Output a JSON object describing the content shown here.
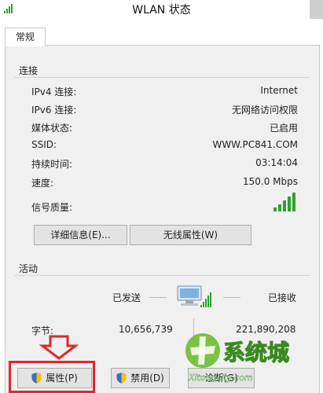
{
  "window": {
    "title": "WLAN 状态"
  },
  "tabs": [
    {
      "label": "常规"
    }
  ],
  "connection": {
    "heading": "连接",
    "rows": [
      {
        "label": "IPv4 连接:",
        "value": "Internet"
      },
      {
        "label": "IPv6 连接:",
        "value": "无网络访问权限"
      },
      {
        "label": "媒体状态:",
        "value": "已启用"
      },
      {
        "label": "SSID:",
        "value": "WWW.PC841.COM"
      },
      {
        "label": "持续时间:",
        "value": "03:14:04"
      },
      {
        "label": "速度:",
        "value": "150.0 Mbps"
      },
      {
        "label": "信号质量:",
        "value": ""
      }
    ],
    "signal_bars": 5,
    "details_button": "详细信息(E)...",
    "wireless_props_button": "无线属性(W)"
  },
  "activity": {
    "heading": "活动",
    "sent_label": "已发送",
    "received_label": "已接收",
    "bytes_label": "字节:",
    "bytes_sent": "10,656,739",
    "bytes_received": "221,890,208"
  },
  "footer": {
    "properties_button": "属性(P)",
    "disable_button": "禁用(D)",
    "diagnose_button": "诊断(G)"
  },
  "watermark": {
    "brand": "系统城",
    "site": "Xitongcity.com"
  },
  "colors": {
    "signal_green": "#2fa12f",
    "highlight_red": "#e1262c",
    "panel_bg": "#f0f0f0"
  },
  "icons": [
    "wifi-network-icon",
    "computer-network-icon",
    "shield-icon",
    "down-arrow-icon",
    "signal-bars-icon"
  ]
}
